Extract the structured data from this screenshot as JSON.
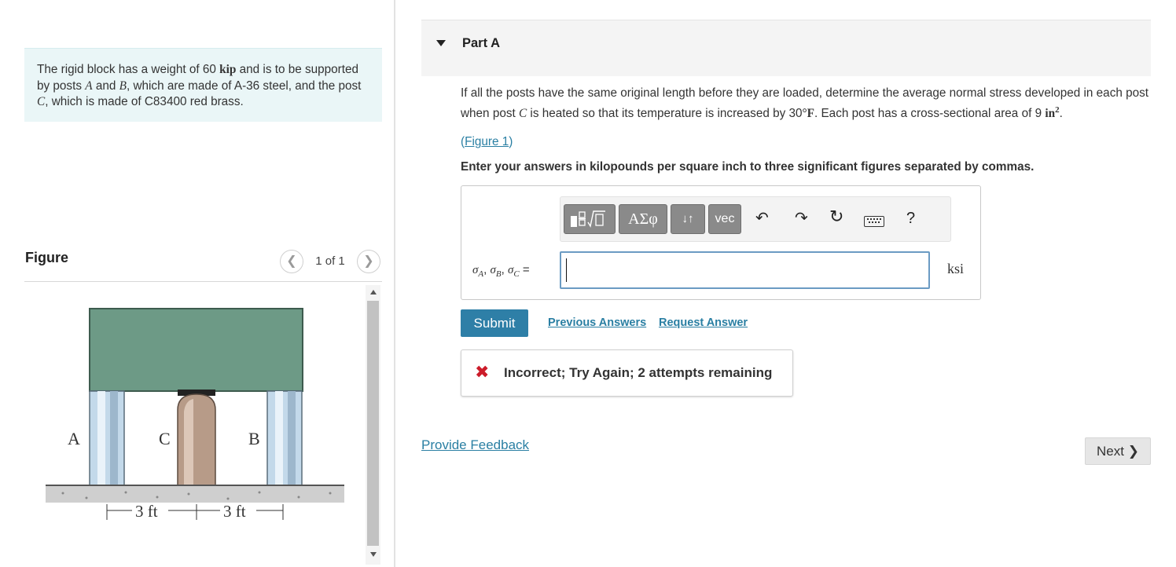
{
  "problem": {
    "text_1": "The rigid block has a weight of 60 ",
    "unit_kip": "kip",
    "text_2": " and is to be supported by posts ",
    "post_a": "A",
    "text_and": " and ",
    "post_b": "B",
    "text_3": ", which are made of A-36 steel, and the post ",
    "post_c": "C",
    "text_4": ", which is made of C83400 red brass."
  },
  "figure_panel": {
    "title": "Figure",
    "counter": "1 of 1",
    "prev_icon": "chevron-left-icon",
    "next_icon": "chevron-right-icon",
    "labels": {
      "a": "A",
      "c": "C",
      "b": "B",
      "dim1": "3 ft",
      "dim2": "3 ft"
    },
    "colors": {
      "block": "#6d9a86",
      "steel": "#c3d9ea",
      "brass": "#b79b88",
      "ground": "#cfcfcf"
    }
  },
  "part": {
    "title": "Part A",
    "caret_icon": "caret-down-icon"
  },
  "question": {
    "text_1": "If all the posts have the same original length before they are loaded, determine the average normal stress developed in each post when post ",
    "var_c": "C",
    "text_2": " is heated so that its temperature is increased by 30",
    "unit_degf": "°F",
    "text_3": ". Each post has a cross-sectional area of 9 ",
    "unit_area": "in",
    "unit_exp": "2",
    "text_4": ".",
    "figure_link": "Figure 1",
    "instructions": "Enter your answers in kilopounds per square inch to three significant figures separated by commas."
  },
  "toolbar": {
    "greek": "ΑΣφ",
    "arrows": "↓↑",
    "vec": "vec",
    "undo_icon": "undo-icon",
    "redo_icon": "redo-icon",
    "reset_icon": "reset-icon",
    "keyboard_icon": "keyboard-icon",
    "help": "?"
  },
  "answer": {
    "sigma": "σ",
    "sub_a": "A",
    "sub_b": "B",
    "sub_c": "C",
    "sep": ", ",
    "equals": " =",
    "value": "",
    "unit": "ksi"
  },
  "actions": {
    "submit": "Submit",
    "previous_answers": "Previous Answers",
    "request_answer": "Request Answer"
  },
  "feedback": {
    "icon": "x-icon",
    "text": "Incorrect; Try Again; 2 attempts remaining"
  },
  "footer": {
    "provide_feedback": "Provide Feedback",
    "next": "Next",
    "next_icon": "chevron-right-icon"
  },
  "colors": {
    "accent": "#2e7fa7",
    "link": "#2a7fa3",
    "error": "#cc1c2a",
    "problem_bg": "#eaf6f7"
  }
}
